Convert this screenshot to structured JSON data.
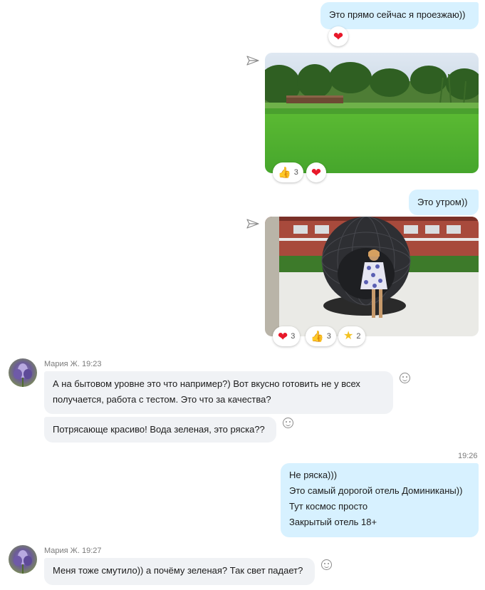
{
  "messages": {
    "m1": {
      "text": "Это прямо сейчас я проезжаю))"
    },
    "m2": {
      "text": "Это утром))"
    },
    "m3": {
      "text": "А на бытовом уровне это что например?) Вот вкусно готовить не у всех получается, работа с тестом. Это что за качества?"
    },
    "m4": {
      "text": "Потрясающе красиво! Вода зеленая, это ряска??"
    },
    "m5": {
      "lines": [
        "Не ряска)))",
        "Это самый дорогой отель Доминиканы))",
        "Тут космос просто",
        "Закрытый отель 18+"
      ]
    },
    "m6": {
      "text": "Меня тоже смутило)) а почёму зеленая? Так свет падает?"
    }
  },
  "senders": {
    "s1": {
      "name": "Мария Ж.",
      "time": "19:23"
    },
    "s2": {
      "name": "Мария Ж.",
      "time": "19:27"
    }
  },
  "timestamps": {
    "t1": "19:26"
  },
  "reactions": {
    "photo1": {
      "like_count": "3"
    },
    "photo2": {
      "heart_count": "3",
      "like_count": "3",
      "star_count": "2"
    }
  },
  "colors": {
    "outgoing_bubble": "#d7f1ff",
    "incoming_bubble": "#f0f2f5",
    "heart": "#e8182a"
  },
  "icons": [
    "heart-icon",
    "thumbs-up-icon",
    "star-icon",
    "send-icon",
    "smiley-icon"
  ]
}
